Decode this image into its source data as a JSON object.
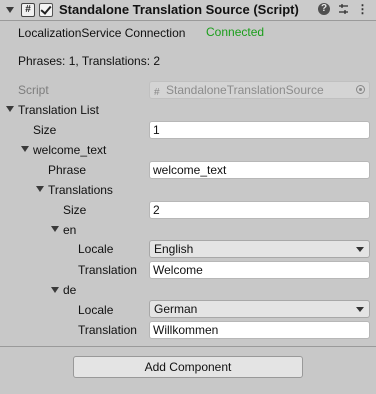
{
  "header": {
    "title": "Standalone Translation Source (Script)",
    "icons": [
      "fold-arrow",
      "script-icon",
      "enabled-checkbox",
      "help-icon",
      "presets-icon",
      "more-menu-icon"
    ]
  },
  "status": {
    "connection_label": "LocalizationService Connection",
    "connection_value": "Connected",
    "connection_color": "#1b9e1b",
    "summary": "Phrases: 1, Translations: 2"
  },
  "script_field": {
    "label": "Script",
    "value": "StandaloneTranslationSource"
  },
  "translation_list": {
    "label": "Translation List",
    "size_label": "Size",
    "size_value": "1",
    "phrase_item": {
      "header": "welcome_text",
      "phrase_label": "Phrase",
      "phrase_value": "welcome_text",
      "translations_label": "Translations",
      "size_label": "Size",
      "size_value": "2",
      "entries": [
        {
          "header": "en",
          "locale_label": "Locale",
          "locale_value": "English",
          "translation_label": "Translation",
          "translation_value": "Welcome"
        },
        {
          "header": "de",
          "locale_label": "Locale",
          "locale_value": "German",
          "translation_label": "Translation",
          "translation_value": "Willkommen"
        }
      ]
    }
  },
  "footer": {
    "add_component_label": "Add Component"
  }
}
